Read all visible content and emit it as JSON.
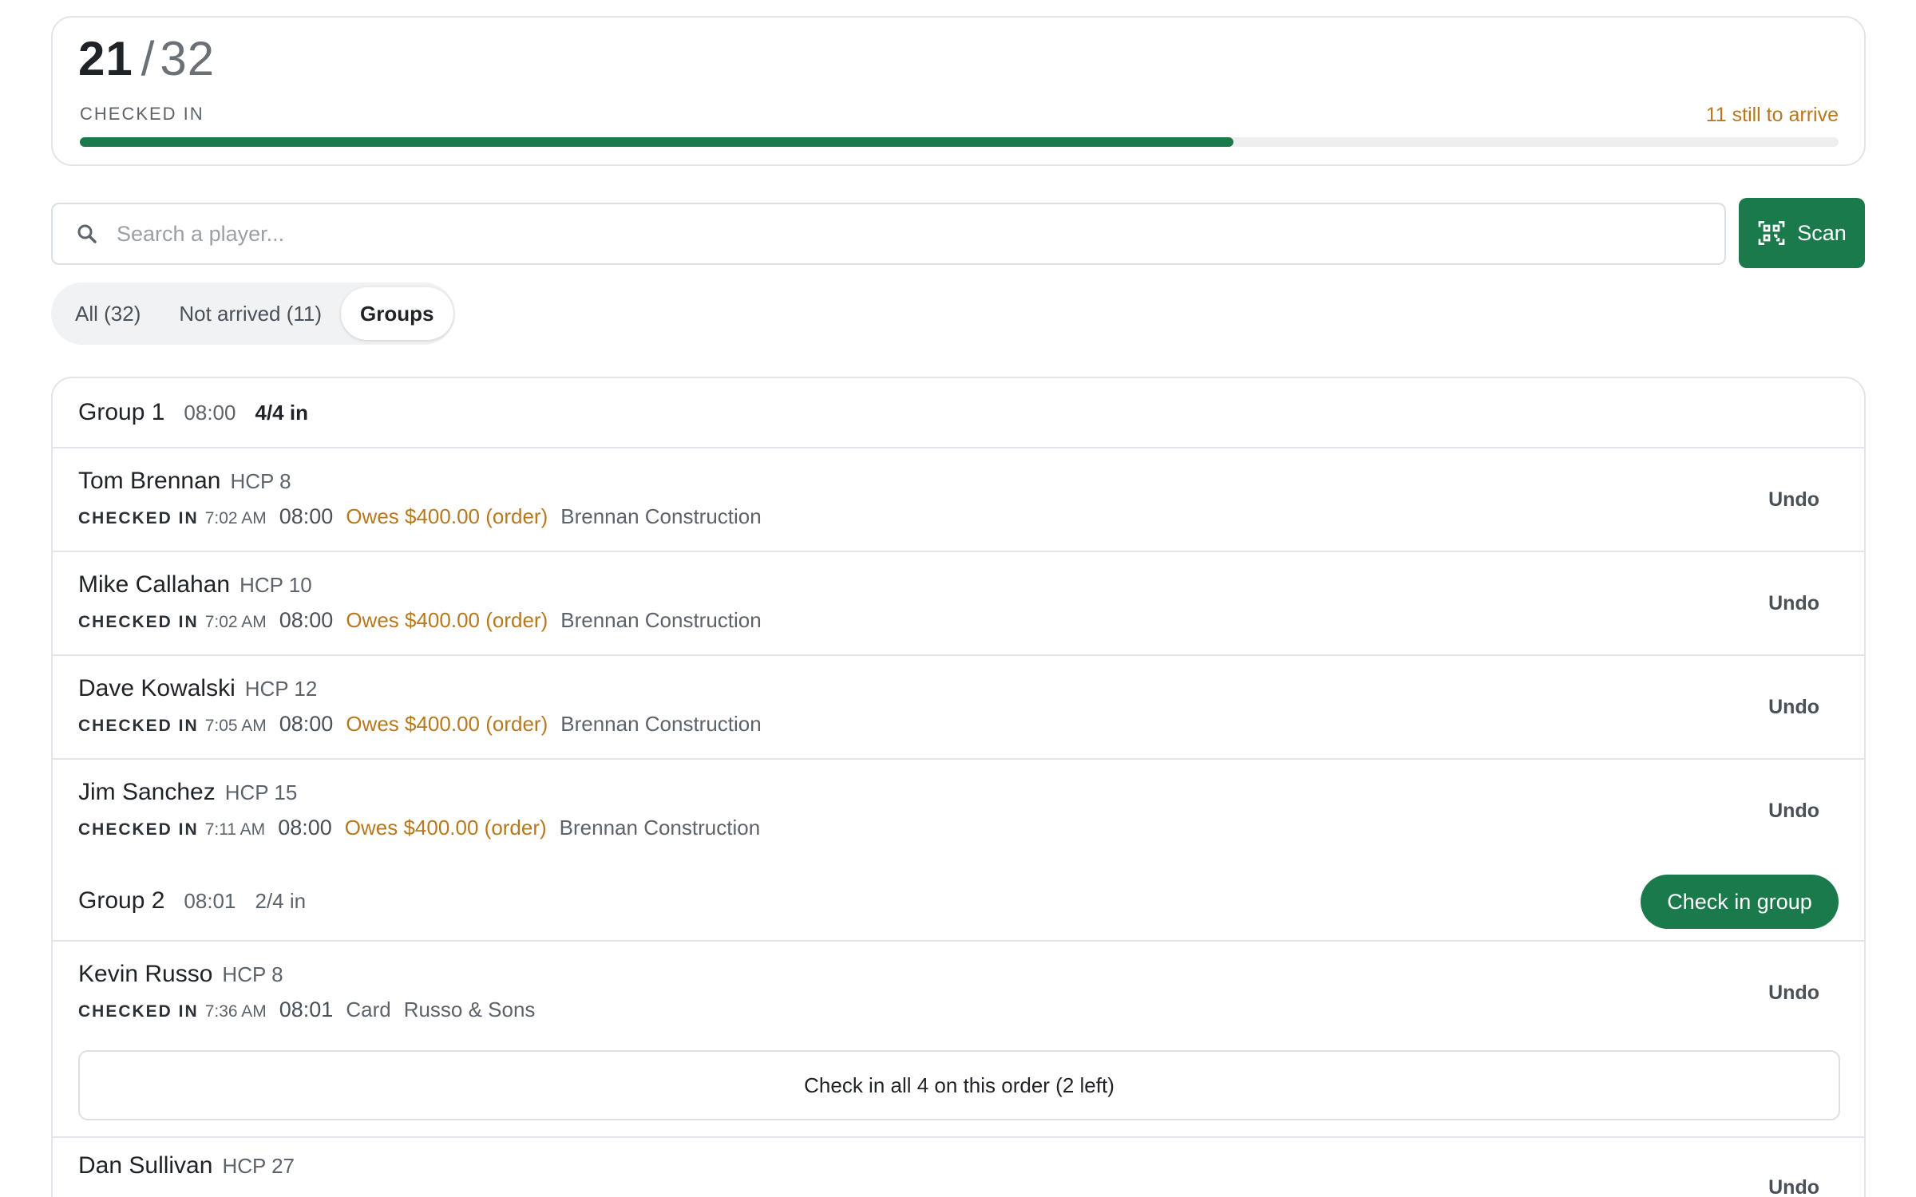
{
  "summary": {
    "checked_in": "21",
    "slash": "/",
    "total": "32",
    "checked_label": "CHECKED IN",
    "still_to_arrive": "11 still to arrive",
    "progress_fraction": 0.656
  },
  "search": {
    "placeholder": "Search a player..."
  },
  "scan": {
    "label": "Scan"
  },
  "tabs": [
    {
      "label": "All (32)"
    },
    {
      "label": "Not arrived (11)"
    },
    {
      "label": "Groups"
    }
  ],
  "groups": [
    {
      "name": "Group 1",
      "time": "08:00",
      "count": "4/4 in",
      "players": [
        {
          "name": "Tom Brennan",
          "hcp": "HCP 8",
          "status": "CHECKED IN",
          "checked_time": "7:02 AM",
          "tee": "08:00",
          "payment": "Owes $400.00 (order)",
          "company": "Brennan Construction",
          "action": "Undo"
        },
        {
          "name": "Mike Callahan",
          "hcp": "HCP 10",
          "status": "CHECKED IN",
          "checked_time": "7:02 AM",
          "tee": "08:00",
          "payment": "Owes $400.00 (order)",
          "company": "Brennan Construction",
          "action": "Undo"
        },
        {
          "name": "Dave Kowalski",
          "hcp": "HCP 12",
          "status": "CHECKED IN",
          "checked_time": "7:05 AM",
          "tee": "08:00",
          "payment": "Owes $400.00 (order)",
          "company": "Brennan Construction",
          "action": "Undo"
        },
        {
          "name": "Jim Sanchez",
          "hcp": "HCP 15",
          "status": "CHECKED IN",
          "checked_time": "7:11 AM",
          "tee": "08:00",
          "payment": "Owes $400.00 (order)",
          "company": "Brennan Construction",
          "action": "Undo"
        }
      ]
    },
    {
      "name": "Group 2",
      "time": "08:01",
      "count": "2/4 in",
      "group_button": "Check in group",
      "players": [
        {
          "name": "Kevin Russo",
          "hcp": "HCP 8",
          "status": "CHECKED IN",
          "checked_time": "7:36 AM",
          "tee": "08:01",
          "payment": "Card",
          "company": "Russo & Sons",
          "action": "Undo"
        },
        {
          "name": "Dan Sullivan",
          "hcp": "HCP 27",
          "action": "Undo"
        }
      ],
      "order_button": "Check in all 4 on this order (2 left)"
    }
  ],
  "colors": {
    "accent": "#1b7a4c",
    "warning": "#b7791f",
    "border": "#e3e5e8"
  }
}
